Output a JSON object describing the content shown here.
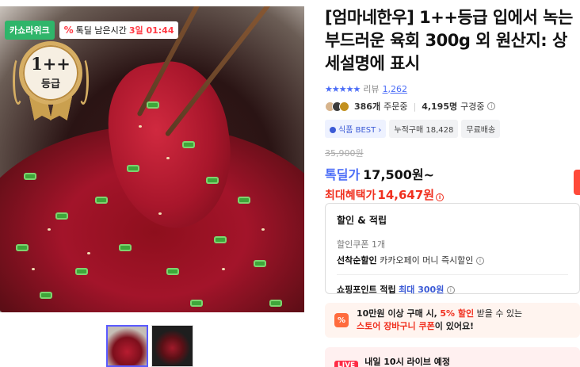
{
  "image": {
    "badge_casa": "카쇼라위크",
    "timer_icon": "%",
    "timer_label": "톡딜 남은시간",
    "timer_value": "3일 01:44",
    "medal_grade": "1++",
    "medal_label": "등급"
  },
  "product": {
    "title": "[엄마네한우] 1++등급 입에서 녹는 부드러운 육회 300g 외 원산지: 상세설명에 표시",
    "stars": "★★★★★",
    "review_label": "리뷰",
    "review_count": "1,262",
    "order_count": "386개",
    "order_suffix": "주문중",
    "subscriber_count": "4,195명",
    "subscriber_suffix": "구경중",
    "chip_best": "식품 BEST",
    "chip_cumulative": "누적구매 18,428",
    "chip_shipping": "무료배송",
    "original_price": "35,900원",
    "sale_label": "톡딜가",
    "sale_price": "17,500원~",
    "max_label": "최대혜택가",
    "max_price": "14,647원"
  },
  "benefits": {
    "title": "할인 & 적립",
    "coupon": "할인쿠폰 1개",
    "firstcome_label": "선착순할인",
    "firstcome_detail": "카카오페이 머니 즉시할인",
    "points_label": "쇼핑포인트 적립",
    "points_value": "최대 300원"
  },
  "promo": {
    "icon": "%",
    "line1_a": "10만원 이상 구매 시,",
    "line1_hl": "5% 할인",
    "line1_b": "받을 수 있는",
    "line2_hl": "스토어 장바구니 쿠폰",
    "line2_b": "이 있어요!"
  },
  "live": {
    "badge": "LIVE",
    "text": "내일 10시 라이브 예정"
  },
  "colors": {
    "accent_blue": "#4a6cf7",
    "accent_red": "#f0301f",
    "badge_green": "#2fb56a"
  }
}
